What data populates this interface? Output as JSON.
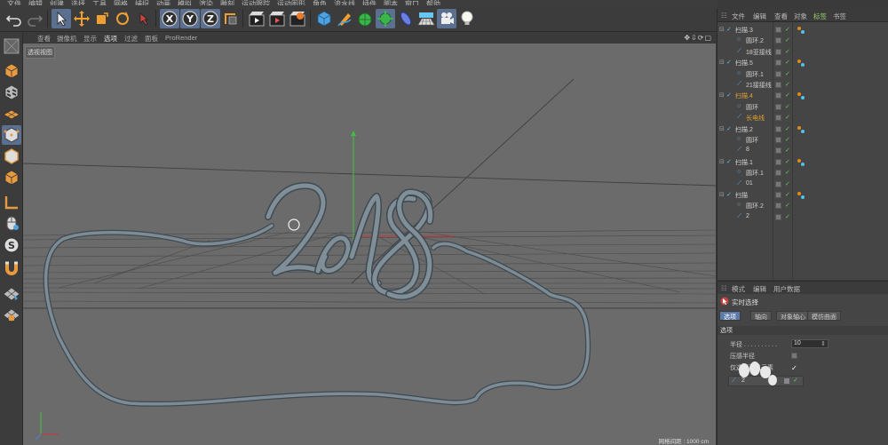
{
  "menubar": {
    "items": [
      "文件",
      "编辑",
      "创建",
      "选择",
      "工具",
      "网格",
      "捕捉",
      "动画",
      "模拟",
      "渲染",
      "雕刻",
      "运动跟踪",
      "运动图形",
      "角色",
      "流水线",
      "插件",
      "脚本",
      "窗口",
      "帮助"
    ]
  },
  "toolbar": {
    "buttons": [
      "undo-icon",
      "redo-icon",
      "select-icon",
      "move-icon",
      "scale-icon",
      "rotate-icon",
      "live-select-icon",
      "x-axis-icon",
      "y-axis-icon",
      "z-axis-icon",
      "coordinate-icon",
      "render-view-icon",
      "render-picture-icon",
      "render-settings-icon",
      "cube-icon",
      "pen-icon",
      "subdivision-icon",
      "deformer-icon",
      "environment-icon",
      "floor-icon",
      "camera-icon",
      "light-icon"
    ],
    "axis_labels": [
      "X",
      "Y",
      "Z"
    ]
  },
  "viewport": {
    "menu": [
      "查看",
      "摄像机",
      "显示",
      "选项",
      "过滤",
      "面板",
      "ProRender"
    ],
    "active_menu": "选项",
    "label": "透视视图",
    "grid_info": "网格间距 : 1000 cm",
    "colors": {
      "bg": "#6b6b6b",
      "tube": "#7d8b94",
      "axis_y": "#3fc33f",
      "axis_x": "#d03030"
    }
  },
  "objects": {
    "header": [
      "文件",
      "编辑",
      "查看",
      "对象",
      "标签",
      "书签"
    ],
    "active_header": "标签",
    "rows": [
      {
        "name": "扫描.3",
        "level": 0,
        "type": "sweep",
        "highlight": false
      },
      {
        "name": "圆环.2",
        "level": 1,
        "type": "circle",
        "highlight": false
      },
      {
        "name": "18亚接线",
        "level": 1,
        "type": "spline",
        "highlight": false
      },
      {
        "name": "扫描.5",
        "level": 0,
        "type": "sweep",
        "highlight": false
      },
      {
        "name": "圆环.1",
        "level": 1,
        "type": "circle",
        "highlight": false
      },
      {
        "name": "21接接线",
        "level": 1,
        "type": "spline",
        "highlight": false
      },
      {
        "name": "扫描.4",
        "level": 0,
        "type": "sweep",
        "highlight": true
      },
      {
        "name": "圆环",
        "level": 1,
        "type": "circle",
        "highlight": false
      },
      {
        "name": "长电线",
        "level": 1,
        "type": "spline",
        "highlight": true
      },
      {
        "name": "扫描.2",
        "level": 0,
        "type": "sweep",
        "highlight": false
      },
      {
        "name": "圆环",
        "level": 1,
        "type": "circle",
        "highlight": false
      },
      {
        "name": "8",
        "level": 1,
        "type": "spline",
        "highlight": false
      },
      {
        "name": "扫描.1",
        "level": 0,
        "type": "sweep",
        "highlight": false
      },
      {
        "name": "圆环.1",
        "level": 1,
        "type": "circle",
        "highlight": false
      },
      {
        "name": "01",
        "level": 1,
        "type": "spline",
        "highlight": false
      },
      {
        "name": "扫描",
        "level": 0,
        "type": "sweep",
        "highlight": false
      },
      {
        "name": "圆环.2",
        "level": 1,
        "type": "circle",
        "highlight": false
      },
      {
        "name": "2",
        "level": 1,
        "type": "spline",
        "highlight": false
      }
    ]
  },
  "attributes": {
    "header": [
      "模式",
      "编辑",
      "用户数据"
    ],
    "title": "实时选择",
    "tabs": [
      "选项",
      "轴向",
      "对象轴心",
      "模仿曲面"
    ],
    "active_tab": "选项",
    "section": "选项",
    "radius_label": "半径 . . . . . . . . . .",
    "radius_value": "10",
    "pressure_label": "压感半径",
    "visible_label": "仅选择可见元素",
    "drag_item": "2"
  }
}
